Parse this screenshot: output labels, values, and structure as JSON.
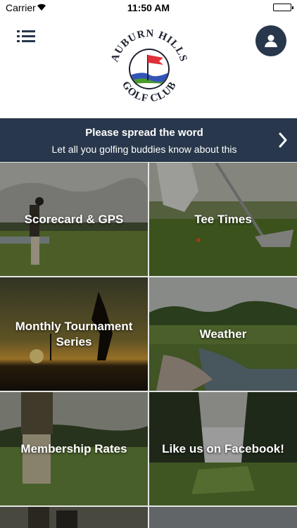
{
  "status_bar": {
    "carrier": "Carrier",
    "time": "11:50 AM"
  },
  "header": {
    "logo_text_top": "AUBURN HILLS",
    "logo_text_bottom": "GOLF CLUB",
    "logo_colors": {
      "flag": "#e0303a",
      "sky": "#3355b8",
      "hill": "#4a9a2e",
      "ring": "#1e2230"
    }
  },
  "banner": {
    "title": "Please spread the word",
    "subtitle": "Let all you golfing buddies know about this"
  },
  "tiles": [
    {
      "label": "Scorecard & GPS"
    },
    {
      "label": "Tee Times"
    },
    {
      "label": "Monthly Tournament Series"
    },
    {
      "label": "Weather"
    },
    {
      "label": "Membership Rates"
    },
    {
      "label": "Like us on Facebook!"
    }
  ],
  "colors": {
    "navy": "#28374b",
    "white": "#ffffff"
  }
}
